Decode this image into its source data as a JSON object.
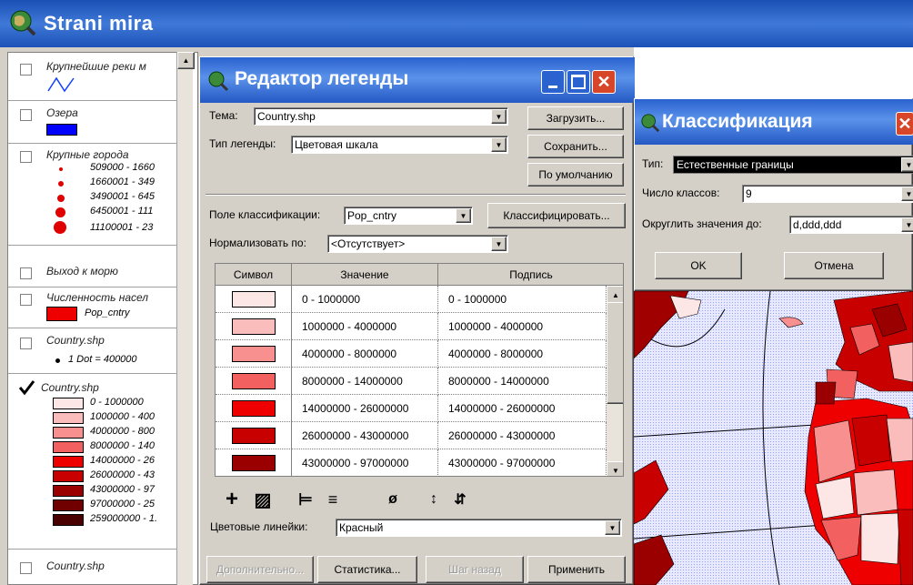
{
  "app": {
    "title": "Strani mira",
    "icon": "globe-icon"
  },
  "toc": {
    "layers": [
      {
        "name": "Крупнейшие реки м",
        "checked": false
      },
      {
        "name": "Озера",
        "checked": false,
        "color": "#0000ff"
      },
      {
        "name": "Крупные города",
        "checked": false
      },
      {
        "name": "Выход к морю",
        "checked": false
      },
      {
        "name": "Численность насел",
        "checked": false,
        "field": "Pop_cntry"
      },
      {
        "name": "Country.shp",
        "checked": false,
        "dot": "1 Dot = 400000"
      },
      {
        "name": "Country.shp",
        "checked": true
      },
      {
        "name": "Country.shp",
        "checked": false
      }
    ],
    "cities": [
      "509000 - 1660",
      "1660001 - 349",
      "3490001 - 645",
      "6450001 - 111",
      "11100001 - 23"
    ],
    "classes": [
      {
        "label": "0 - 1000000",
        "color": "#fde6e6"
      },
      {
        "label": "1000000 - 400",
        "color": "#fbbcbc"
      },
      {
        "label": "4000000 - 800",
        "color": "#f89090"
      },
      {
        "label": "8000000 - 140",
        "color": "#f36060"
      },
      {
        "label": "14000000 - 26",
        "color": "#ee0000"
      },
      {
        "label": "26000000 - 43",
        "color": "#c80000"
      },
      {
        "label": "43000000 - 97",
        "color": "#9a0000"
      },
      {
        "label": "97000000 - 25",
        "color": "#700000"
      },
      {
        "label": "259000000 - 1.",
        "color": "#4a0000"
      }
    ]
  },
  "editor": {
    "title": "Редактор легенды",
    "theme_label": "Тема:",
    "theme_value": "Country.shp",
    "legend_type_label": "Тип легенды:",
    "legend_type_value": "Цветовая шкала",
    "load": "Загрузить...",
    "save": "Сохранить...",
    "default": "По умолчанию",
    "class_field_label": "Поле классификации:",
    "class_field_value": "Pop_cntry",
    "classify": "Классифицировать...",
    "normalize_label": "Нормализовать по:",
    "normalize_value": "<Отсутствует>",
    "columns": [
      "Символ",
      "Значение",
      "Подпись"
    ],
    "rows": [
      {
        "value": "0 - 1000000",
        "label": "0 - 1000000",
        "color": "#fde6e6"
      },
      {
        "value": "1000000 - 4000000",
        "label": "1000000 - 4000000",
        "color": "#fbbcbc"
      },
      {
        "value": "4000000 - 8000000",
        "label": "4000000 - 8000000",
        "color": "#f89090"
      },
      {
        "value": "8000000 - 14000000",
        "label": "8000000 - 14000000",
        "color": "#f36060"
      },
      {
        "value": "14000000 - 26000000",
        "label": "14000000 - 26000000",
        "color": "#ee0000"
      },
      {
        "value": "26000000 - 43000000",
        "label": "26000000 - 43000000",
        "color": "#c80000"
      },
      {
        "value": "43000000 - 97000000",
        "label": "43000000 - 97000000",
        "color": "#9a0000"
      }
    ],
    "toolbar": [
      "+",
      "▨",
      "⊨",
      "≡",
      "ø",
      "↕",
      "⇵"
    ],
    "ramp_label": "Цветовые линейки:",
    "ramp_value": "Красный",
    "advanced": "Дополнительно...",
    "stats": "Статистика...",
    "undo": "Шаг назад",
    "apply": "Применить"
  },
  "classif": {
    "title": "Классификация",
    "type_label": "Тип:",
    "type_value": "Естественные границы",
    "count_label": "Число классов:",
    "count_value": "9",
    "round_label": "Округлить значения до:",
    "round_value": "d,ddd,ddd",
    "ok": "OK",
    "cancel": "Отмена"
  }
}
